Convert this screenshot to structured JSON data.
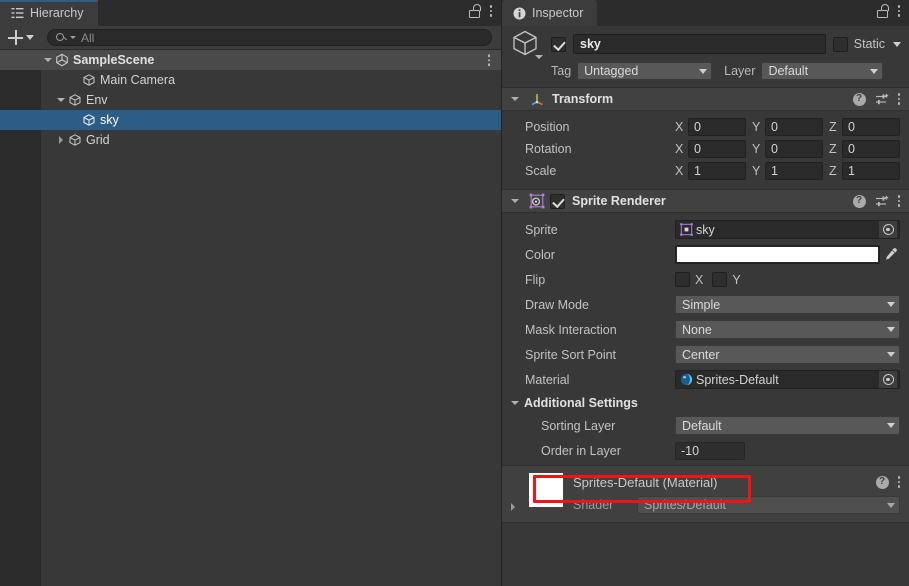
{
  "hierarchy": {
    "tab": {
      "label": "Hierarchy",
      "icon": "hierarchy-icon"
    },
    "toolbar": {
      "add_label": "+",
      "search_placeholder": "All"
    },
    "tree": [
      {
        "label": "SampleScene",
        "icon": "unity-scene-icon",
        "depth": 0,
        "expanded": true,
        "selected": false,
        "kind": "scene"
      },
      {
        "label": "Main Camera",
        "icon": "gameobject-cube-icon",
        "depth": 2,
        "expanded": null,
        "selected": false,
        "kind": "object"
      },
      {
        "label": "Env",
        "icon": "gameobject-cube-icon",
        "depth": 1,
        "expanded": true,
        "selected": false,
        "kind": "object"
      },
      {
        "label": "sky",
        "icon": "gameobject-cube-icon",
        "depth": 2,
        "expanded": null,
        "selected": true,
        "kind": "object"
      },
      {
        "label": "Grid",
        "icon": "gameobject-cube-icon",
        "depth": 1,
        "expanded": false,
        "selected": false,
        "kind": "object"
      }
    ]
  },
  "inspector": {
    "tab": {
      "label": "Inspector",
      "icon": "info-circle-icon"
    },
    "object": {
      "enabled": true,
      "name": "sky",
      "static_label": "Static",
      "static_checked": false,
      "tag_label": "Tag",
      "tag_value": "Untagged",
      "layer_label": "Layer",
      "layer_value": "Default"
    },
    "transform": {
      "title": "Transform",
      "expanded": true,
      "rows": [
        {
          "label": "Position",
          "x": "0",
          "y": "0",
          "z": "0"
        },
        {
          "label": "Rotation",
          "x": "0",
          "y": "0",
          "z": "0"
        },
        {
          "label": "Scale",
          "x": "1",
          "y": "1",
          "z": "1"
        }
      ],
      "axis_labels": {
        "x": "X",
        "y": "Y",
        "z": "Z"
      }
    },
    "sprite_renderer": {
      "title": "Sprite Renderer",
      "expanded": true,
      "enabled": true,
      "sprite_label": "Sprite",
      "sprite_value": "sky",
      "color_label": "Color",
      "color_value": "#ffffff",
      "flip_label": "Flip",
      "flip_x_label": "X",
      "flip_y_label": "Y",
      "flip_x": false,
      "flip_y": false,
      "draw_mode_label": "Draw Mode",
      "draw_mode_value": "Simple",
      "mask_interaction_label": "Mask Interaction",
      "mask_interaction_value": "None",
      "sort_point_label": "Sprite Sort Point",
      "sort_point_value": "Center",
      "material_label": "Material",
      "material_value": "Sprites-Default",
      "additional_settings_label": "Additional Settings",
      "additional_settings_expanded": true,
      "sorting_layer_label": "Sorting Layer",
      "sorting_layer_value": "Default",
      "order_in_layer_label": "Order in Layer",
      "order_in_layer_value": "-10"
    },
    "material_preview": {
      "title": "Sprites-Default (Material)",
      "shader_label": "Shader",
      "shader_value": "Sprites/Default",
      "swatch_color": "#ffffff"
    }
  },
  "annotation": {
    "highlight_color": "#f41313",
    "highlight_target": "order-in-layer-row"
  }
}
